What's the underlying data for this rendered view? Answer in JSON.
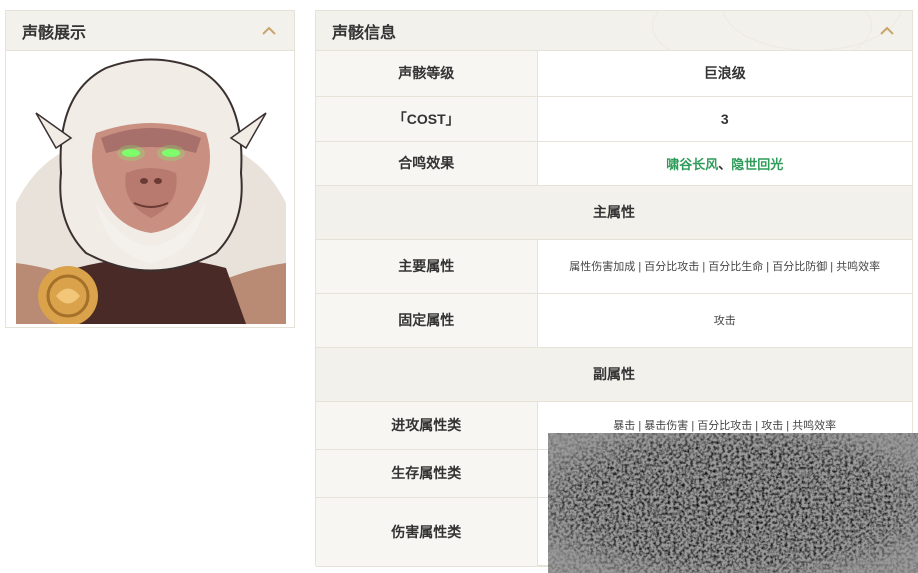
{
  "showcase": {
    "title": "声骸展示",
    "collapse_icon": "chevron-up-icon"
  },
  "info": {
    "title": "声骸信息",
    "collapse_icon": "chevron-up-icon",
    "rows": {
      "level": {
        "label": "声骸等级",
        "value": "巨浪级"
      },
      "cost": {
        "label": "「COST」",
        "value": "3"
      },
      "sonata": {
        "label": "合鸣效果",
        "value_1": "啸谷长风",
        "separator": "、",
        "value_2": "隐世回光"
      },
      "main_section": "主属性",
      "main_attr": {
        "label": "主要属性",
        "value": "属性伤害加成 | 百分比攻击 | 百分比生命 | 百分比防御 | 共鸣效率"
      },
      "fixed_attr": {
        "label": "固定属性",
        "value": "攻击"
      },
      "sub_section": "副属性",
      "offense": {
        "label": "进攻属性类",
        "value": "暴击 | 暴击伤害 | 百分比攻击 | 攻击 | 共鸣效率"
      },
      "survival": {
        "label": "生存属性类",
        "value": ""
      },
      "damage": {
        "label": "伤害属性类",
        "value": ""
      }
    }
  },
  "colors": {
    "accent_gold": "#c9a56b",
    "green_text": "#2f9c5a",
    "header_bg": "#f3f1ec",
    "border": "#e6e2d8"
  }
}
